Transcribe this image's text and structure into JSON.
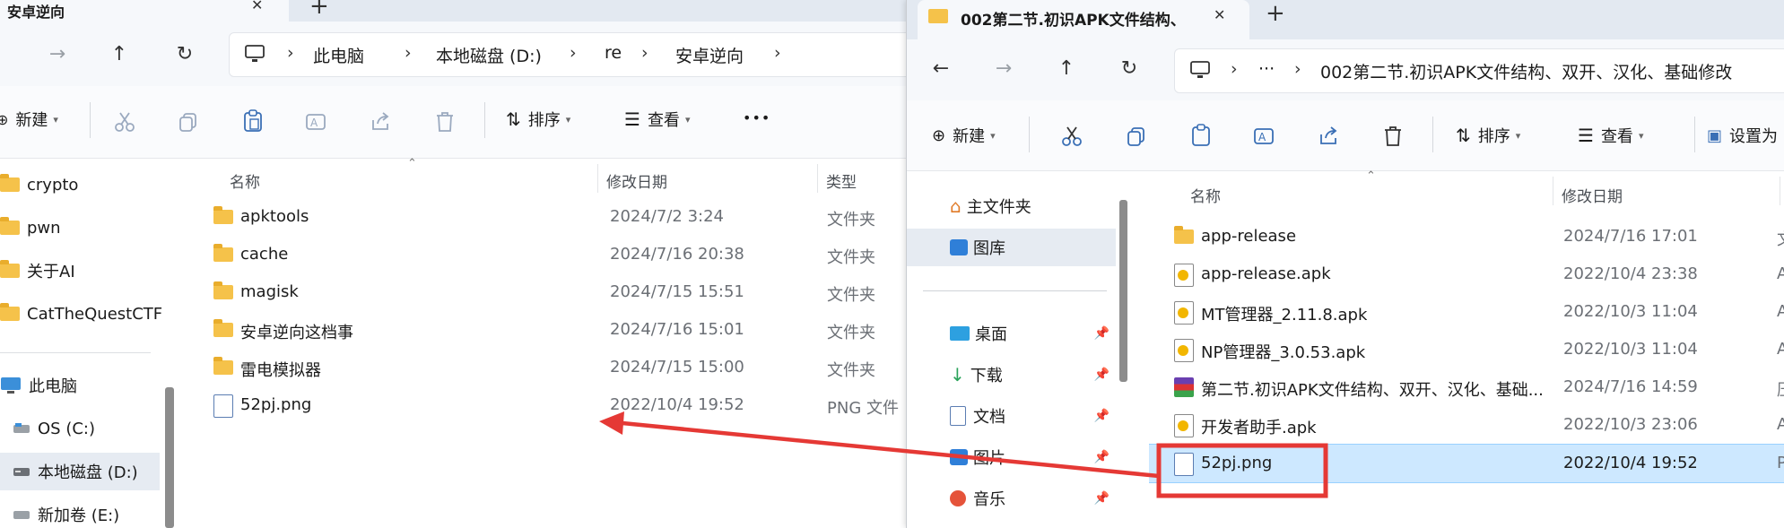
{
  "left_window": {
    "tab_title": "安卓逆向",
    "new_tab_symbol": "+",
    "tab_close_symbol": "✕",
    "nav": {
      "forward": "→",
      "up": "↑",
      "refresh": "↻"
    },
    "breadcrumb": [
      "此电脑",
      "本地磁盘 (D:)",
      "re",
      "安卓逆向"
    ],
    "toolbar": {
      "new_label": "新建",
      "sort_label": "排序",
      "view_label": "查看",
      "more_label": "•••"
    },
    "sidebar": [
      {
        "label": "crypto",
        "type": "folder"
      },
      {
        "label": "pwn",
        "type": "folder"
      },
      {
        "label": "关于AI",
        "type": "folder"
      },
      {
        "label": "CatTheQuestCTF",
        "type": "folder"
      },
      {
        "label": "此电脑",
        "type": "pc"
      },
      {
        "label": "OS (C:)",
        "type": "drive"
      },
      {
        "label": "本地磁盘 (D:)",
        "type": "drive",
        "selected": true
      },
      {
        "label": "新加卷 (E:)",
        "type": "drive"
      }
    ],
    "columns": {
      "name": "名称",
      "modified": "修改日期",
      "type": "类型"
    },
    "files": [
      {
        "name": "apktools",
        "modified": "2024/7/2 3:24",
        "type": "文件夹",
        "icon": "folder"
      },
      {
        "name": "cache",
        "modified": "2024/7/16 20:38",
        "type": "文件夹",
        "icon": "folder"
      },
      {
        "name": "magisk",
        "modified": "2024/7/15 15:51",
        "type": "文件夹",
        "icon": "folder"
      },
      {
        "name": "安卓逆向这档事",
        "modified": "2024/7/16 15:01",
        "type": "文件夹",
        "icon": "folder"
      },
      {
        "name": "雷电模拟器",
        "modified": "2024/7/15 15:00",
        "type": "文件夹",
        "icon": "folder"
      },
      {
        "name": "52pj.png",
        "modified": "2022/10/4 19:52",
        "type": "PNG 文件",
        "icon": "image"
      }
    ]
  },
  "right_window": {
    "tab_title": "002第二节.初识APK文件结构、",
    "new_tab_symbol": "+",
    "tab_close_symbol": "✕",
    "nav": {
      "back": "←",
      "forward": "→",
      "up": "↑",
      "refresh": "↻"
    },
    "address_more": "···",
    "breadcrumb": [
      "002第二节.初识APK文件结构、双开、汉化、基础修改"
    ],
    "toolbar": {
      "new_label": "新建",
      "sort_label": "排序",
      "view_label": "查看",
      "setas_label": "设置为"
    },
    "sidebar": [
      {
        "label": "主文件夹",
        "icon": "home-icon",
        "pinned": false
      },
      {
        "label": "图库",
        "icon": "gallery-icon",
        "pinned": false,
        "selected": true
      },
      {
        "label": "桌面",
        "icon": "desktop-icon",
        "pinned": true
      },
      {
        "label": "下载",
        "icon": "download-icon",
        "pinned": true
      },
      {
        "label": "文档",
        "icon": "document-icon",
        "pinned": true
      },
      {
        "label": "图片",
        "icon": "pictures-icon",
        "pinned": true
      },
      {
        "label": "音乐",
        "icon": "music-icon",
        "pinned": true
      }
    ],
    "columns": {
      "name": "名称",
      "modified": "修改日期"
    },
    "files": [
      {
        "name": "app-release",
        "modified": "2024/7/16 17:01",
        "type_initial": "文",
        "icon": "folder"
      },
      {
        "name": "app-release.apk",
        "modified": "2022/10/4 23:38",
        "type_initial": "A",
        "icon": "apk"
      },
      {
        "name": "MT管理器_2.11.8.apk",
        "modified": "2022/10/3 11:04",
        "type_initial": "A",
        "icon": "apk"
      },
      {
        "name": "NP管理器_3.0.53.apk",
        "modified": "2022/10/3 11:04",
        "type_initial": "A",
        "icon": "apk"
      },
      {
        "name": "第二节.初识APK文件结构、双开、汉化、基础...",
        "modified": "2024/7/16 14:59",
        "type_initial": "压",
        "icon": "archive"
      },
      {
        "name": "开发者助手.apk",
        "modified": "2022/10/3 23:06",
        "type_initial": "A",
        "icon": "apk"
      },
      {
        "name": "52pj.png",
        "modified": "2022/10/4 19:52",
        "type_initial": "P",
        "icon": "image",
        "selected": true
      }
    ]
  },
  "annotation": {
    "color": "#e53935",
    "meaning": "drag 52pj.png from right window to left window"
  }
}
